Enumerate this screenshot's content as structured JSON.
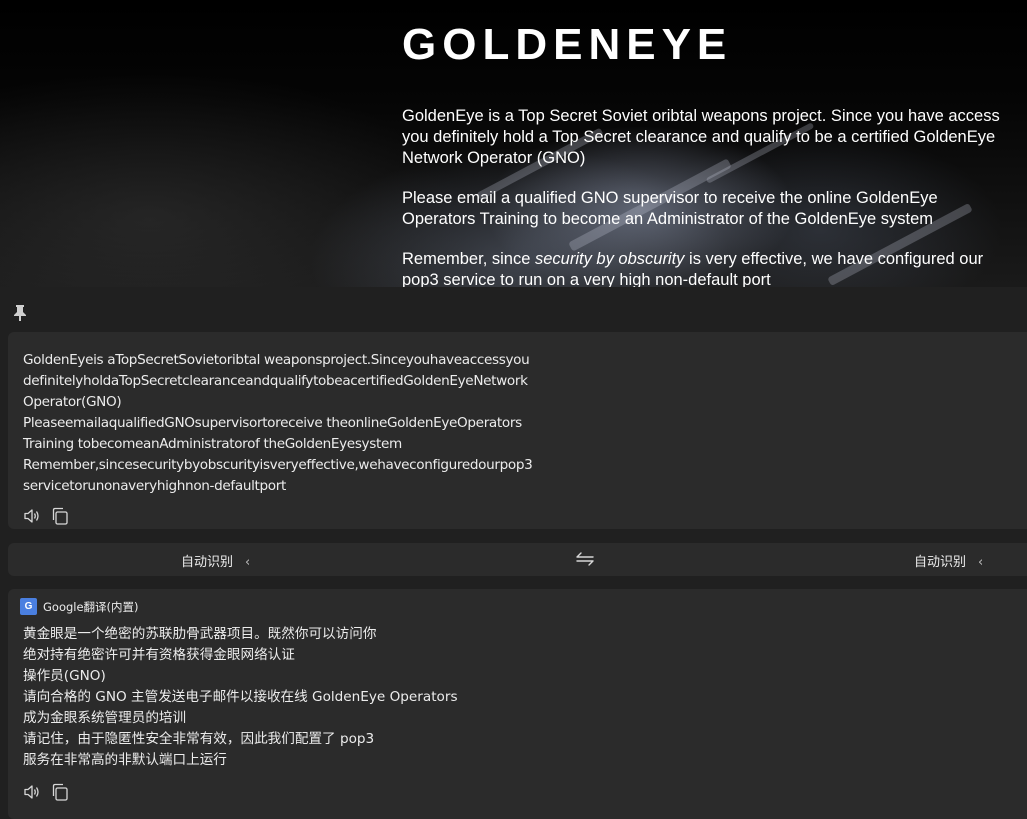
{
  "webpage": {
    "title": "GOLDENEYE",
    "para1": "GoldenEye is a Top Secret Soviet oribtal weapons project. Since you have access you definitely hold a Top Secret clearance and qualify to be a certified GoldenEye Network Operator (GNO)",
    "para2": "Please email a qualified GNO supervisor to receive the online GoldenEye Operators Training to become an Administrator of the GoldenEye system",
    "para3_before": "Remember, since ",
    "para3_em": "security by obscurity",
    "para3_after": " is very effective, we have configured our pop3 service to run on a very high non-default port"
  },
  "translator": {
    "source_lines": [
      "GoldenEyeis aTopSecretSovietoribtal weaponsproject.Sinceyouhaveaccessyou",
      "definitelyholdaTopSecretclearanceandqualifytobeacertifiedGoldenEyeNetwork",
      "Operator(GNO)",
      "PleaseemailaqualifiedGNOsupervisortoreceive theonlineGoldenEyeOperators",
      "Training tobecomeanAdministratorof theGoldenEyesystem",
      "Remember,sincesecuritybyobscurityisveryeffective,wehaveconfiguredourpop3",
      "servicetorunonaveryhighnon-defaultport"
    ],
    "source_language": "自动识别",
    "target_language": "自动识别",
    "engine_name": "Google翻译(内置)",
    "engine_icon_text": "G",
    "result_lines": [
      "黄金眼是一个绝密的苏联肋骨武器项目。既然你可以访问你",
      "绝对持有绝密许可并有资格获得金眼网络认证",
      "操作员(GNO)",
      "请向合格的 GNO 主管发送电子邮件以接收在线 GoldenEye Operators",
      "成为金眼系统管理员的培训",
      "请记住，由于隐匿性安全非常有效，因此我们配置了 pop3",
      "服务在非常高的非默认端口上运行"
    ],
    "icons": {
      "pin": "pin-icon",
      "speaker": "speaker-icon",
      "copy": "copy-icon",
      "swap": "swap-arrows-icon",
      "chevron": "chevron-left-icon"
    }
  }
}
